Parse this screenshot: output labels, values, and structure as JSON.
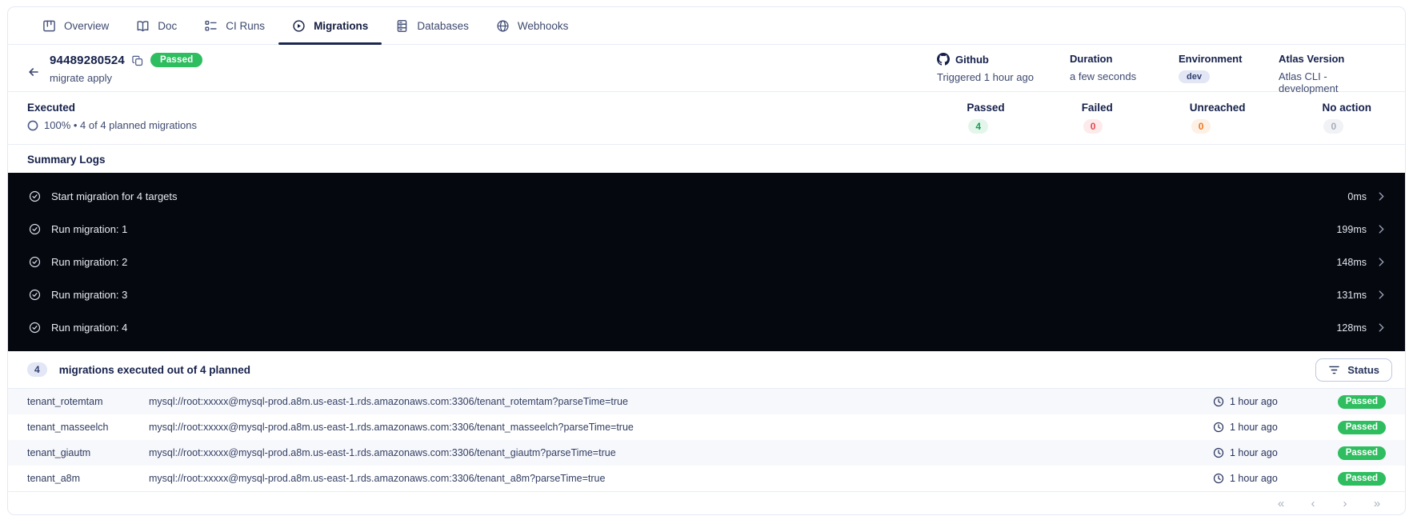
{
  "tabs": [
    {
      "label": "Overview"
    },
    {
      "label": "Doc"
    },
    {
      "label": "CI Runs"
    },
    {
      "label": "Migrations",
      "active": true
    },
    {
      "label": "Databases"
    },
    {
      "label": "Webhooks"
    }
  ],
  "header": {
    "run_id": "94489280524",
    "status": "Passed",
    "command": "migrate apply",
    "meta": [
      {
        "label": "Github",
        "value": "Triggered 1 hour ago"
      },
      {
        "label": "Duration",
        "value": "a few seconds"
      },
      {
        "label": "Environment",
        "value": "dev"
      },
      {
        "label": "Atlas Version",
        "value": "Atlas CLI - development"
      }
    ]
  },
  "executed": {
    "title": "Executed",
    "progress": "100% • 4 of 4 planned migrations",
    "stats": [
      {
        "label": "Passed",
        "value": "4"
      },
      {
        "label": "Failed",
        "value": "0"
      },
      {
        "label": "Unreached",
        "value": "0"
      },
      {
        "label": "No action",
        "value": "0"
      }
    ]
  },
  "summary_logs": {
    "title": "Summary Logs",
    "rows": [
      {
        "text": "Start migration for 4 targets",
        "duration": "0ms"
      },
      {
        "text": "Run migration: 1",
        "duration": "199ms"
      },
      {
        "text": "Run migration: 2",
        "duration": "148ms"
      },
      {
        "text": "Run migration: 3",
        "duration": "131ms"
      },
      {
        "text": "Run migration: 4",
        "duration": "128ms"
      }
    ]
  },
  "table": {
    "count": "4",
    "title": "migrations executed out of 4 planned",
    "status_button": "Status",
    "rows": [
      {
        "name": "tenant_rotemtam",
        "url": "mysql://root:xxxxx@mysql-prod.a8m.us-east-1.rds.amazonaws.com:3306/tenant_rotemtam?parseTime=true",
        "time": "1 hour ago",
        "status": "Passed"
      },
      {
        "name": "tenant_masseelch",
        "url": "mysql://root:xxxxx@mysql-prod.a8m.us-east-1.rds.amazonaws.com:3306/tenant_masseelch?parseTime=true",
        "time": "1 hour ago",
        "status": "Passed"
      },
      {
        "name": "tenant_giautm",
        "url": "mysql://root:xxxxx@mysql-prod.a8m.us-east-1.rds.amazonaws.com:3306/tenant_giautm?parseTime=true",
        "time": "1 hour ago",
        "status": "Passed"
      },
      {
        "name": "tenant_a8m",
        "url": "mysql://root:xxxxx@mysql-prod.a8m.us-east-1.rds.amazonaws.com:3306/tenant_a8m?parseTime=true",
        "time": "1 hour ago",
        "status": "Passed"
      }
    ]
  },
  "pagination": {
    "first": "«",
    "prev": "‹",
    "next": "›",
    "last": "»"
  },
  "colors": {
    "passed_green": "#2ebd5f",
    "stat_green": "#1a9e50",
    "stat_red": "#e5484d",
    "stat_orange": "#e87b28",
    "navy": "#15204a",
    "log_panel": "#05080f",
    "env_pill_bg": "#e2e6f5"
  }
}
